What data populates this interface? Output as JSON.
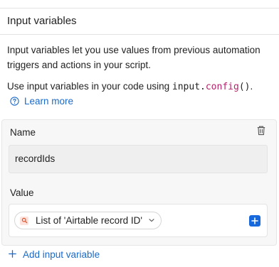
{
  "section": {
    "title": "Input variables",
    "description": "Input variables let you use values from previous automation triggers and actions in your script.",
    "usage_prefix": "Use input variables in your code using ",
    "usage_code_object": "input.",
    "usage_code_method": "config",
    "usage_code_suffix": "()",
    "usage_end": ".",
    "learn_more": "Learn more"
  },
  "variable": {
    "name_label": "Name",
    "name_value": "recordIds",
    "value_label": "Value",
    "value_token": "List of 'Airtable record ID'"
  },
  "add_variable_label": "Add input variable",
  "colors": {
    "link": "#1a6ac9",
    "accent": "#1668dc",
    "code_method": "#b4236a",
    "card_bg": "#f7f7f7"
  },
  "icons": {
    "learn_more": "question-circle-icon",
    "delete": "trash-icon",
    "token": "search-record-icon",
    "dropdown": "chevron-down-icon",
    "add_token": "plus-square-icon",
    "add_variable": "plus-icon"
  }
}
